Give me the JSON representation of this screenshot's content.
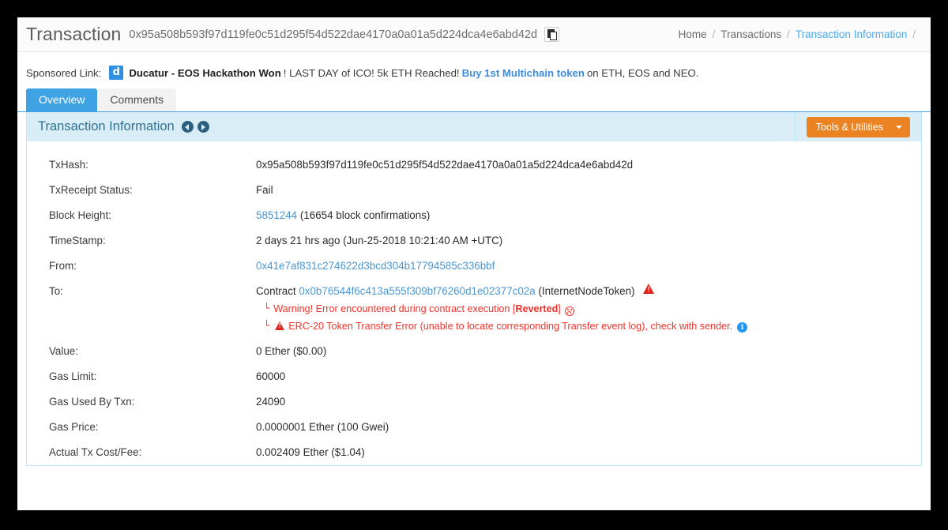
{
  "header": {
    "title": "Transaction",
    "hash": "0x95a508b593f97d119fe0c51d295f54d522dae4170a0a01a5d224dca4e6abd42d",
    "copy_icon": "copy-icon",
    "breadcrumb": [
      {
        "label": "Home",
        "active": false
      },
      {
        "label": "Transactions",
        "active": false
      },
      {
        "label": "Transaction Information",
        "active": true
      }
    ],
    "breadcrumb_separator": "/"
  },
  "sponsored": {
    "label": "Sponsored Link:",
    "logo_letter": "d",
    "logo_color": "#2f8fe0",
    "brand": "Ducatur - EOS Hackathon Won",
    "text_after_brand": "! LAST DAY of ICO! 5k ETH Reached!",
    "link": "Buy 1st Multichain token",
    "text_tail": "on ETH, EOS and NEO."
  },
  "tabs": [
    {
      "label": "Overview",
      "active": true
    },
    {
      "label": "Comments",
      "active": false
    }
  ],
  "panel": {
    "title": "Transaction Information",
    "prev_icon": "chevron-left-circle-icon",
    "next_icon": "chevron-right-circle-icon",
    "tools_button": "Tools & Utilities",
    "tools_caret_icon": "caret-down-icon",
    "accent_orange": "#ec8323",
    "accent_blue": "#31708f"
  },
  "details": {
    "txhash": {
      "key": "TxHash:",
      "value": "0x95a508b593f97d119fe0c51d295f54d522dae4170a0a01a5d224dca4e6abd42d"
    },
    "status": {
      "key": "TxReceipt Status:",
      "value": "Fail",
      "color": "#ff3a2f"
    },
    "block": {
      "key": "Block Height:",
      "link": "5851244",
      "suffix": "(16654 block confirmations)"
    },
    "timestamp": {
      "key": "TimeStamp:",
      "value": "2 days 21 hrs ago (Jun-25-2018 10:21:40 AM +UTC)"
    },
    "from": {
      "key": "From:",
      "link": "0x41e7af831c274622d3bcd304b17794585c336bbf"
    },
    "to": {
      "key": "To:",
      "prefix": "Contract",
      "link": "0x0b76544f6c413a555f309bf76260d1e02377c02a",
      "suffix": "(InternetNodeToken)",
      "warning_icon": "warning-triangle-icon",
      "warning1_prefix": "Warning! Error encountered during contract execution [",
      "warning1_bold": "Reverted",
      "warning1_suffix": "]",
      "warning1_emoji": "frowning-face-icon",
      "warning2": "ERC-20 Token Transfer Error (unable to locate corresponding Transfer event log), check with sender.",
      "warning2_icon": "warning-triangle-icon",
      "info_icon": "info-circle-icon"
    },
    "value": {
      "key": "Value:",
      "value": "0 Ether ($0.00)"
    },
    "gas_limit": {
      "key": "Gas Limit:",
      "value": "60000"
    },
    "gas_used": {
      "key": "Gas Used By Txn:",
      "value": "24090"
    },
    "gas_price": {
      "key": "Gas Price:",
      "value": "0.0000001 Ether (100 Gwei)"
    },
    "tx_fee": {
      "key": "Actual Tx Cost/Fee:",
      "value": "0.002409 Ether ($1.04)"
    }
  }
}
